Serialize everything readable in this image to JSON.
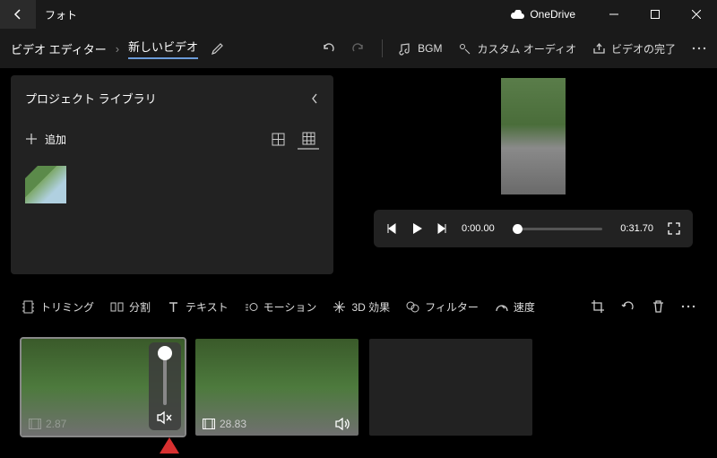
{
  "titlebar": {
    "app_name": "フォト",
    "onedrive_label": "OneDrive"
  },
  "breadcrumb": {
    "root": "ビデオ エディター",
    "current": "新しいビデオ"
  },
  "toolbar": {
    "bgm": "BGM",
    "custom_audio": "カスタム オーディオ",
    "finish": "ビデオの完了"
  },
  "library": {
    "title": "プロジェクト ライブラリ",
    "add": "追加"
  },
  "player": {
    "current": "0:00.00",
    "total": "0:31.70"
  },
  "clipbar": {
    "trim": "トリミング",
    "split": "分割",
    "text": "テキスト",
    "motion": "モーション",
    "effect_3d": "3D 効果",
    "filter": "フィルター",
    "speed": "速度"
  },
  "clips": [
    {
      "duration": "2.87"
    },
    {
      "duration": "28.83"
    }
  ]
}
